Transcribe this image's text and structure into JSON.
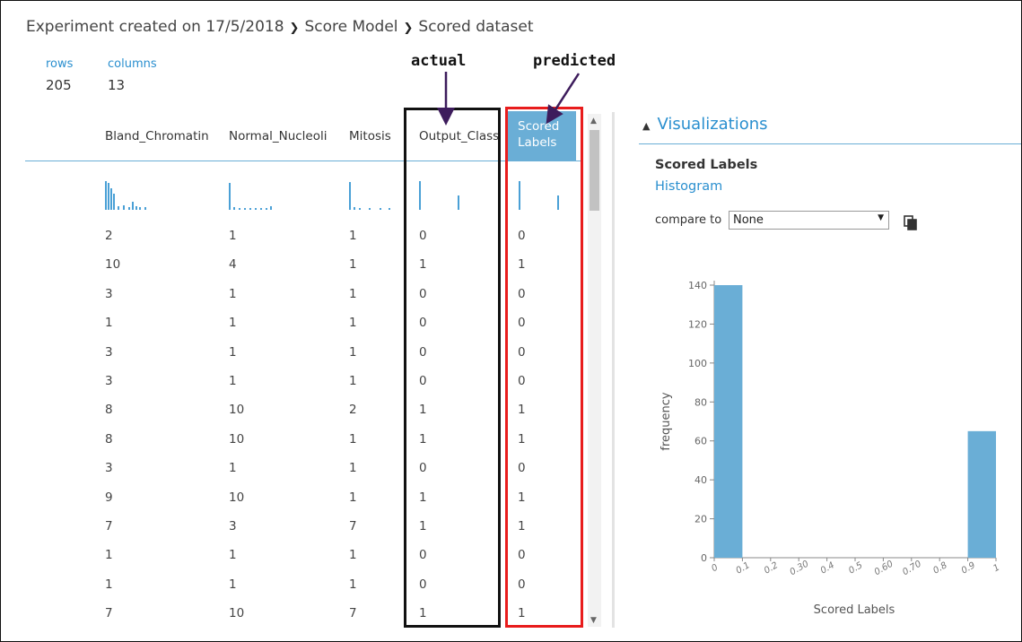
{
  "breadcrumb": [
    "Experiment created on 17/5/2018",
    "Score Model",
    "Scored dataset"
  ],
  "stats": {
    "rows_label": "rows",
    "rows_value": "205",
    "columns_label": "columns",
    "columns_value": "13"
  },
  "columns": [
    "Bland_Chromatin",
    "Normal_Nucleoli",
    "Mitosis",
    "Output_Class",
    "Scored Labels"
  ],
  "scored_header_lines": [
    "Scored",
    "Labels"
  ],
  "rows": [
    [
      "2",
      "1",
      "1",
      "0",
      "0"
    ],
    [
      "10",
      "4",
      "1",
      "1",
      "1"
    ],
    [
      "3",
      "1",
      "1",
      "0",
      "0"
    ],
    [
      "1",
      "1",
      "1",
      "0",
      "0"
    ],
    [
      "3",
      "1",
      "1",
      "0",
      "0"
    ],
    [
      "3",
      "1",
      "1",
      "0",
      "0"
    ],
    [
      "8",
      "10",
      "2",
      "1",
      "1"
    ],
    [
      "8",
      "10",
      "1",
      "1",
      "1"
    ],
    [
      "3",
      "1",
      "1",
      "0",
      "0"
    ],
    [
      "9",
      "10",
      "1",
      "1",
      "1"
    ],
    [
      "7",
      "3",
      "7",
      "1",
      "1"
    ],
    [
      "1",
      "1",
      "1",
      "0",
      "0"
    ],
    [
      "1",
      "1",
      "1",
      "0",
      "0"
    ],
    [
      "7",
      "10",
      "7",
      "1",
      "1"
    ]
  ],
  "annotations": {
    "actual": "actual",
    "predicted": "predicted"
  },
  "visualizations": {
    "title": "Visualizations",
    "column_name": "Scored Labels",
    "chart_type": "Histogram",
    "compare_label": "compare to",
    "compare_value": "None"
  },
  "colors": {
    "accent": "#2a8fcf",
    "bar": "#6aaed6",
    "actual_box": "#111111",
    "predicted_box": "#e81c1c"
  },
  "icons": {
    "copy": "copy-icon",
    "dropdown": "chevron-down-icon",
    "collapse": "triangle-up-icon"
  },
  "chart_data": {
    "type": "bar",
    "categories": [
      "0",
      "0.1",
      "0.2",
      "0.30",
      "0.4",
      "0.5",
      "0.60",
      "0.70",
      "0.8",
      "0.9",
      "1"
    ],
    "bins": [
      [
        0,
        0.1
      ],
      [
        0.9,
        1
      ]
    ],
    "values": [
      140,
      65
    ],
    "xlabel": "Scored Labels",
    "ylabel": "frequency",
    "yticks": [
      0,
      20,
      40,
      60,
      80,
      100,
      120,
      140
    ],
    "ylim": [
      0,
      150
    ],
    "xlim": [
      0,
      1
    ]
  }
}
